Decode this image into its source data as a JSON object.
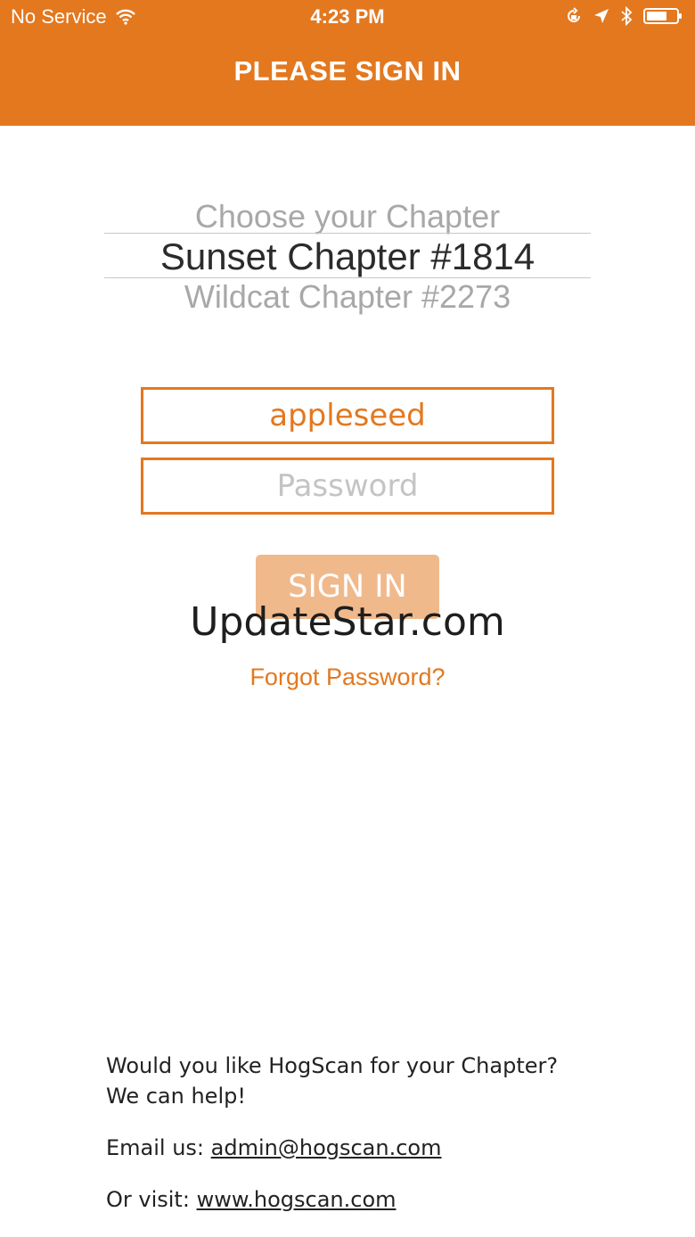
{
  "status_bar": {
    "carrier": "No Service",
    "time": "4:23 PM",
    "icons": [
      "wifi-icon",
      "orientation-lock-icon",
      "location-icon",
      "bluetooth-icon",
      "battery-icon"
    ]
  },
  "header": {
    "title": "PLEASE SIGN IN",
    "background_color": "#E3781F"
  },
  "chapter_picker": {
    "above": "Choose your Chapter",
    "selected": "Sunset Chapter  #1814",
    "below": "Wildcat Chapter  #2273"
  },
  "form": {
    "username_value": "appleseed",
    "password_placeholder": "Password",
    "signin_label": "SIGN IN",
    "forgot_label": "Forgot Password?"
  },
  "watermark": "UpdateStar.com",
  "footer": {
    "line1": "Would you like HogScan for your Chapter?",
    "line2": "We can help!",
    "email_prefix": "Email us: ",
    "email": "admin@hogscan.com",
    "visit_prefix": "Or visit: ",
    "website": "www.hogscan.com"
  },
  "colors": {
    "accent": "#E3781F",
    "button_disabled": "#F0B98C"
  }
}
